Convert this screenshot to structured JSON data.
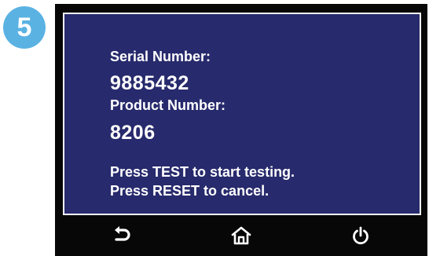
{
  "step_badge": "5",
  "screen": {
    "serial_label": "Serial Number:",
    "serial_value": "9885432",
    "product_label": "Product Number:",
    "product_value": "8206",
    "instruction_test": "Press TEST to start testing.",
    "instruction_reset": "Press RESET to cancel."
  },
  "nav": {
    "icons": [
      "back-icon",
      "home-icon",
      "power-icon"
    ]
  },
  "colors": {
    "screen_bg": "#272a6c",
    "badge": "#5ab2e3",
    "bezel": "#070707",
    "text": "#ffffff"
  }
}
